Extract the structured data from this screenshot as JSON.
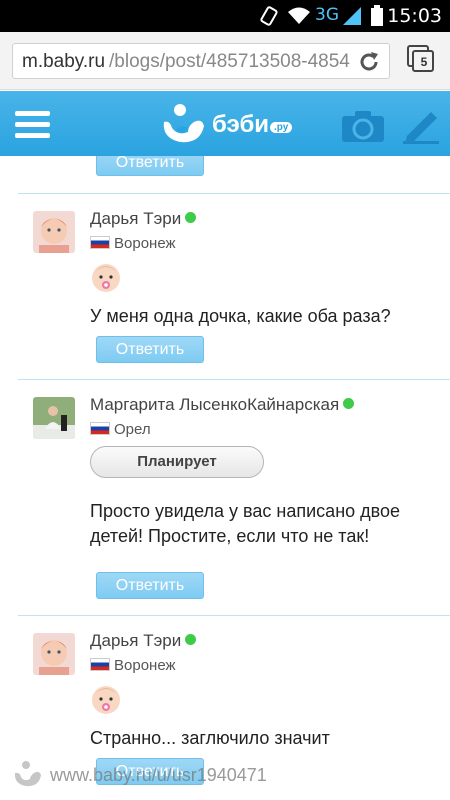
{
  "status_bar": {
    "network": "3G",
    "time": "15:03"
  },
  "browser": {
    "url_host": "m.baby.ru",
    "url_path": "/blogs/post/485713508-4854",
    "tab_count": "5"
  },
  "app_header": {
    "logo_text": "бэби",
    "logo_suffix": ".ру"
  },
  "reply_label": "Ответить",
  "comments": [
    {
      "author": "Дарья Тэри",
      "online": true,
      "city": "Воронеж",
      "text": "У меня одна дочка, какие оба раза?"
    },
    {
      "author": "Маргарита ЛысенкоКайнарская",
      "online": true,
      "city": "Орел",
      "status": "Планирует",
      "text": "Просто увидела у вас написано двое детей! Простите, если что не так!"
    },
    {
      "author": "Дарья Тэри",
      "online": true,
      "city": "Воронеж",
      "text": "Странно... заглючило значит"
    }
  ],
  "watermark": "www.baby.ru/u/usr1940471",
  "colors": {
    "header": "#2aa3e0",
    "button": "#7ecbf2",
    "online": "#3ecb4a"
  }
}
